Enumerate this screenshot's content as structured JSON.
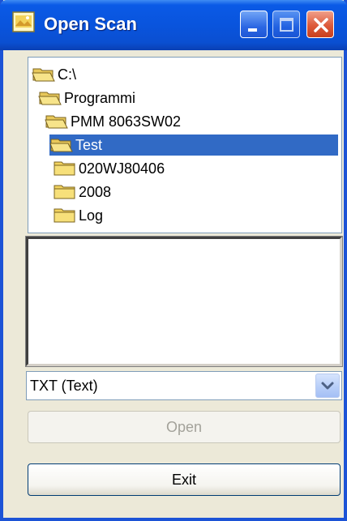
{
  "window": {
    "title": "Open Scan",
    "controls": {
      "minimize": "minimize-icon",
      "maximize": "maximize-icon",
      "close": "close-icon"
    }
  },
  "tree": {
    "items": [
      {
        "label": "C:\\",
        "icon": "open-folder-icon",
        "selected": false
      },
      {
        "label": "Programmi",
        "icon": "open-folder-icon",
        "selected": false
      },
      {
        "label": "PMM 8063SW02",
        "icon": "open-folder-icon",
        "selected": false
      },
      {
        "label": "Test",
        "icon": "open-folder-icon",
        "selected": true
      },
      {
        "label": "020WJ80406",
        "icon": "folder-icon",
        "selected": false
      },
      {
        "label": "2008",
        "icon": "folder-icon",
        "selected": false
      },
      {
        "label": "Log",
        "icon": "folder-icon",
        "selected": false
      }
    ]
  },
  "file_list": {
    "items": []
  },
  "file_type": {
    "selected": "TXT (Text)"
  },
  "buttons": {
    "open_label": "Open",
    "open_enabled": false,
    "exit_label": "Exit"
  },
  "colors": {
    "title_bar": "#0954dd",
    "selection": "#316ac5",
    "window_bg": "#ece9d8",
    "close_button": "#dd5a3a"
  }
}
